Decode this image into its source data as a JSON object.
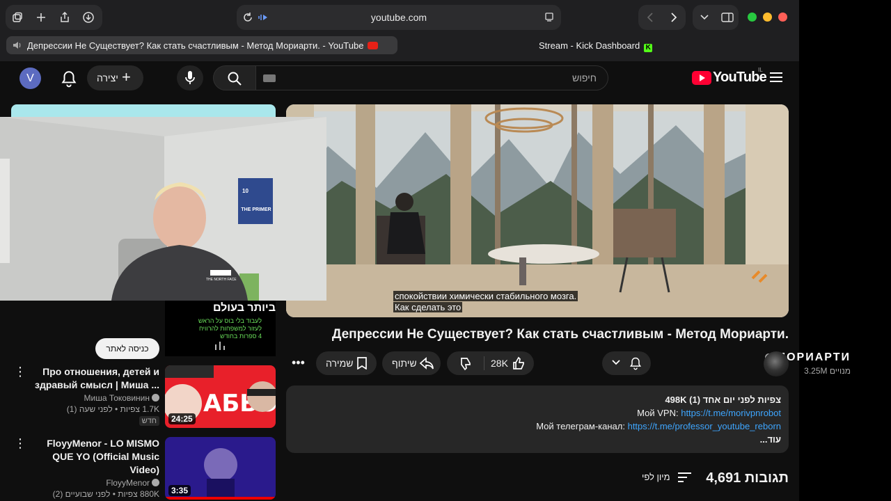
{
  "browser": {
    "url": "youtube.com",
    "tabs": [
      {
        "title": "Депрессии Не Существует? Как стать счастливым - Метод Мориарти. - YouTube",
        "active": true
      },
      {
        "title": "Stream - Kick Dashboard",
        "active": false
      }
    ],
    "colors": {
      "close": "#ff5f57",
      "minimize": "#febc2e",
      "zoom": "#28c840"
    }
  },
  "header": {
    "avatar_letter": "V",
    "create_label": "יצירה",
    "search_placeholder": "חיפוש",
    "logo_text": "YouTube",
    "logo_country": "IL"
  },
  "video": {
    "subtitle_line1": "спокойствии химически стабильного мозга.",
    "subtitle_line2": "Как сделать это",
    "title": "Депрессии Не Существует? Как стать счастливым - Метод Мориарти.",
    "likes": "28K",
    "share_label": "שיתוף",
    "save_label": "שמירה"
  },
  "channel": {
    "name": "МОРИАРТИ",
    "subscribers": "3.25M מנויים"
  },
  "description": {
    "stats": "498K צפיות  לפני יום אחד (1)",
    "vpn_label": "Мой VPN: ",
    "vpn_link": "https://t.me/morivpnrobot",
    "tg_label": "Мой телеграм-канал: ",
    "tg_link": "https://t.me/professor_youtube_reborn",
    "more": "...עוד"
  },
  "comments": {
    "count": "4,691 תגובות",
    "sort_label": "מיון לפי"
  },
  "ad": {
    "title": "ביותר בעולם",
    "lines": [
      "לעבוד בלי בוס על הראש",
      "לעזור למשפחות להרוויח",
      "4 ספרות בחודש"
    ],
    "visit_label": "כניסה לאתר"
  },
  "recommendations": [
    {
      "title": "Про отношения, детей и здравый смысл | Миша ...",
      "channel": "Миша Токовинин",
      "stats": "1.7K צפיות • לפני שעה (1)",
      "badge": "חדש",
      "duration": "24:25"
    },
    {
      "title": "FloyyMenor - LO MISMO QUE YO (Official Music Video)",
      "channel": "FloyyMenor",
      "stats": "880K צפיות • לפני שבועיים (2)",
      "badge": "",
      "duration": "3:35"
    }
  ],
  "cam": {
    "poster_text": "THE PRIMER",
    "poster_number": "10",
    "shirt_text": "THE NORTH FACE"
  }
}
